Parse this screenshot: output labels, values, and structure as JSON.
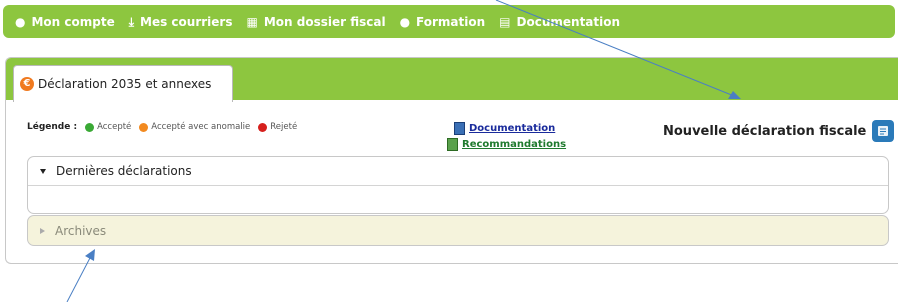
{
  "nav": {
    "items": [
      {
        "icon": "user-icon",
        "label": "Mon compte"
      },
      {
        "icon": "download-icon",
        "label": "Mes courriers"
      },
      {
        "icon": "folder-icon",
        "label": "Mon dossier fiscal"
      },
      {
        "icon": "chat-icon",
        "label": "Formation"
      },
      {
        "icon": "document-icon",
        "label": "Documentation"
      }
    ],
    "color": "#8dc63f"
  },
  "tab": {
    "label": "Déclaration 2035 et annexes",
    "icon": "euro-icon"
  },
  "legend": {
    "title": "Légende :",
    "items": [
      {
        "label": "Accepté",
        "color": "#3aa935"
      },
      {
        "label": "Accepté avec anomalie",
        "color": "#f28a20"
      },
      {
        "label": "Rejeté",
        "color": "#d6201d"
      }
    ]
  },
  "links": {
    "documentation": "Documentation",
    "recommandations": "Recommandations"
  },
  "new_declaration": {
    "label": "Nouvelle déclaration fiscale",
    "icon": "new-declaration-icon"
  },
  "sections": {
    "recent": "Dernières déclarations",
    "archives": "Archives"
  }
}
